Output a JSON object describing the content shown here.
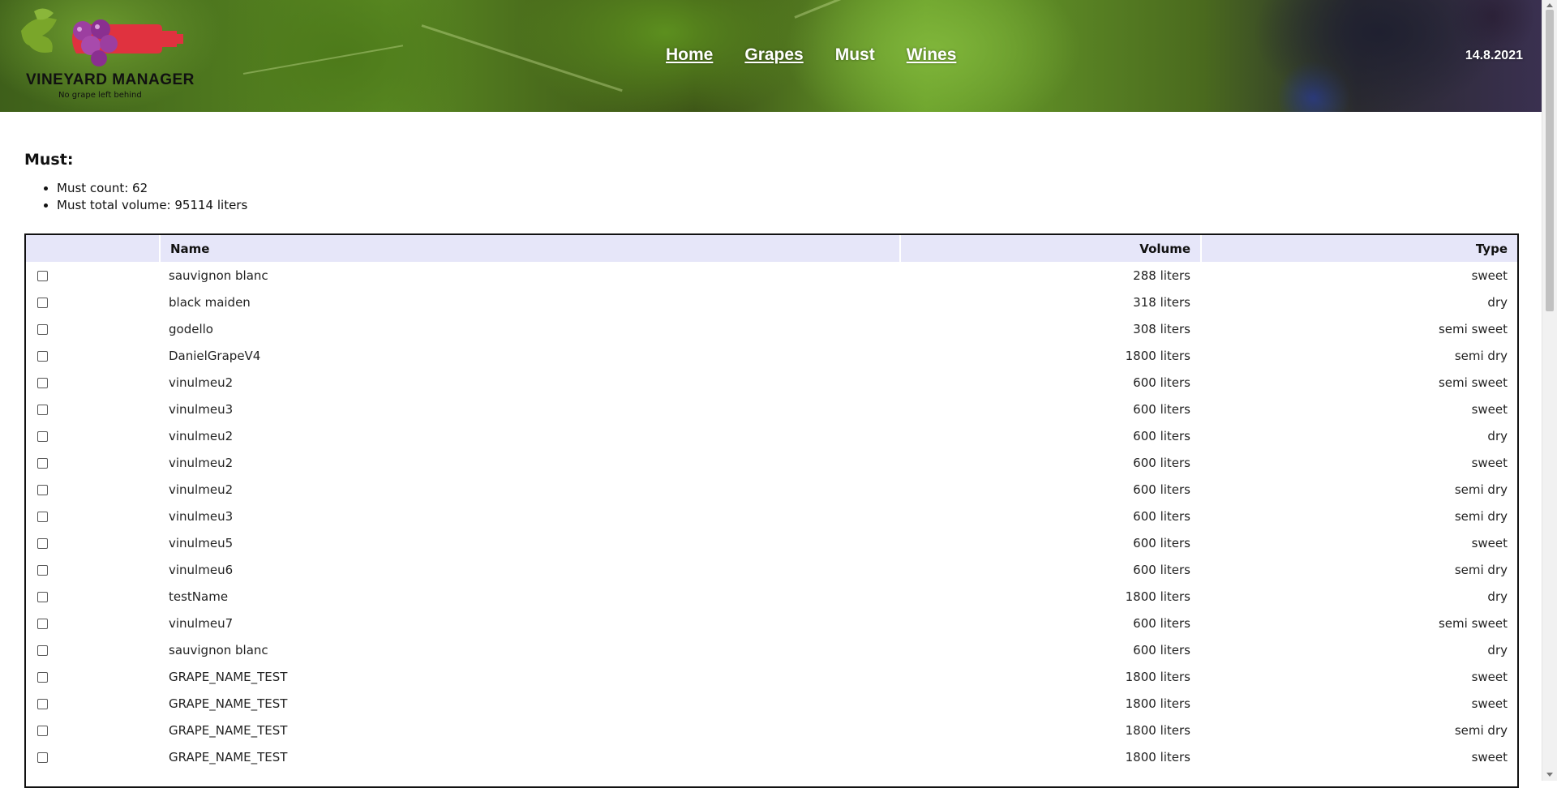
{
  "header": {
    "brand": "VINEYARD MANAGER",
    "tagline": "No grape left behind",
    "nav": [
      {
        "label": "Home",
        "active": false
      },
      {
        "label": "Grapes",
        "active": false
      },
      {
        "label": "Must",
        "active": true
      },
      {
        "label": "Wines",
        "active": false
      }
    ],
    "date": "14.8.2021"
  },
  "page": {
    "title": "Must:",
    "stats": [
      "Must count: 62",
      "Must total volume: 95114 liters"
    ]
  },
  "table": {
    "headers": {
      "name": "Name",
      "volume": "Volume",
      "type": "Type"
    },
    "rows": [
      {
        "name": "sauvignon blanc",
        "volume": "288 liters",
        "type": "sweet"
      },
      {
        "name": "black maiden",
        "volume": "318 liters",
        "type": "dry"
      },
      {
        "name": "godello",
        "volume": "308 liters",
        "type": "semi sweet"
      },
      {
        "name": "DanielGrapeV4",
        "volume": "1800 liters",
        "type": "semi dry"
      },
      {
        "name": "vinulmeu2",
        "volume": "600 liters",
        "type": "semi sweet"
      },
      {
        "name": "vinulmeu3",
        "volume": "600 liters",
        "type": "sweet"
      },
      {
        "name": "vinulmeu2",
        "volume": "600 liters",
        "type": "dry"
      },
      {
        "name": "vinulmeu2",
        "volume": "600 liters",
        "type": "sweet"
      },
      {
        "name": "vinulmeu2",
        "volume": "600 liters",
        "type": "semi dry"
      },
      {
        "name": "vinulmeu3",
        "volume": "600 liters",
        "type": "semi dry"
      },
      {
        "name": "vinulmeu5",
        "volume": "600 liters",
        "type": "sweet"
      },
      {
        "name": "vinulmeu6",
        "volume": "600 liters",
        "type": "semi dry"
      },
      {
        "name": "testName",
        "volume": "1800 liters",
        "type": "dry"
      },
      {
        "name": "vinulmeu7",
        "volume": "600 liters",
        "type": "semi sweet"
      },
      {
        "name": "sauvignon blanc",
        "volume": "600 liters",
        "type": "dry"
      },
      {
        "name": "GRAPE_NAME_TEST",
        "volume": "1800 liters",
        "type": "sweet"
      },
      {
        "name": "GRAPE_NAME_TEST",
        "volume": "1800 liters",
        "type": "sweet"
      },
      {
        "name": "GRAPE_NAME_TEST",
        "volume": "1800 liters",
        "type": "semi dry"
      },
      {
        "name": "GRAPE_NAME_TEST",
        "volume": "1800 liters",
        "type": "sweet"
      }
    ]
  },
  "colors": {
    "header_bg": "#e6e6f9",
    "logo_bottle": "#e0323f",
    "logo_grapes": "#9c3ea0",
    "logo_leaf": "#7aa62a"
  },
  "icons": {
    "logo": "grape-bottle-logo-icon",
    "checkbox": "checkbox-icon"
  }
}
